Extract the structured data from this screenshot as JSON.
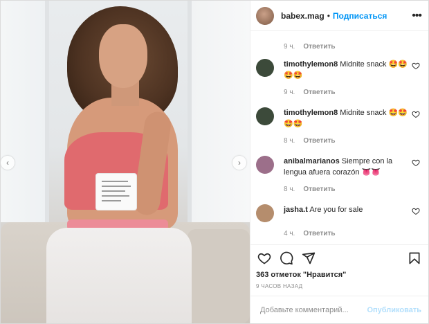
{
  "post": {
    "username": "babex.mag",
    "separator": "•",
    "follow_label": "Подписаться",
    "more_icon": "more-horizontal-icon",
    "first_meta": {
      "time": "9 ч.",
      "reply": "Ответить"
    },
    "comments": [
      {
        "user": "timothylemon8",
        "text": "Midnite snack 🤩🤩🤩🤩",
        "time": "9 ч.",
        "reply": "Ответить",
        "avatar_color": "#3c4a3a"
      },
      {
        "user": "timothylemon8",
        "text": "Midnite snack 🤩🤩🤩🤩",
        "time": "8 ч.",
        "reply": "Ответить",
        "avatar_color": "#3c4a3a"
      },
      {
        "user": "anibalmarianos",
        "text": "Siempre con la lengua afuera corazón 👅👅",
        "time": "8 ч.",
        "reply": "Ответить",
        "avatar_color": "#9c6f8a"
      },
      {
        "user": "jasha.t",
        "text": "Are you for sale",
        "time": "4 ч.",
        "reply": "Ответить",
        "avatar_color": "#b58d6d"
      }
    ],
    "likes_text": "363 отметок \"Нравится\"",
    "posted_text": "9 ЧАСОВ НАЗАД",
    "add_comment_placeholder": "Добавьте комментарий...",
    "publish_label": "Опубликовать",
    "accent_color": "#0095f6",
    "icons": [
      "heart-icon",
      "comment-icon",
      "share-icon",
      "bookmark-icon"
    ]
  },
  "photo": {
    "mug_text": "I NEED THIS MUG"
  }
}
